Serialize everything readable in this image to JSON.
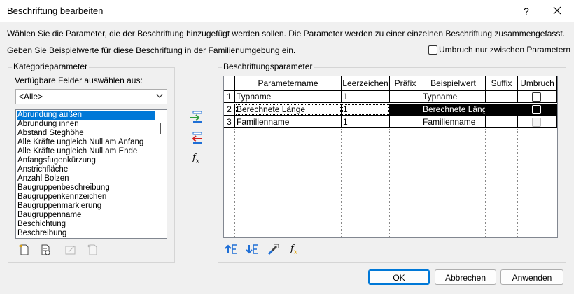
{
  "window": {
    "title": "Beschriftung bearbeiten",
    "help_label": "?"
  },
  "descriptions": {
    "line1": "Wählen Sie die Parameter, die der Beschriftung hinzugefügt werden sollen. Die Parameter werden zu einer einzelnen Beschriftung zusammengefasst.",
    "line2": "Geben Sie Beispielwerte für diese Beschriftung in der Familienumgebung ein."
  },
  "wrap_option": {
    "label": "Umbruch nur zwischen Parametern",
    "checked": false
  },
  "category": {
    "group_label": "Kategorieparameter",
    "fields_label": "Verfügbare Felder auswählen aus:",
    "filter_value": "<Alle>",
    "items": [
      "Abrundung außen",
      "Abrundung innen",
      "Abstand Steghöhe",
      "Alle Kräfte ungleich Null am Anfang",
      "Alle Kräfte ungleich Null am Ende",
      "Anfangsfugenkürzung",
      "Anstrichfläche",
      "Anzahl Bolzen",
      "Baugruppenbeschreibung",
      "Baugruppenkennzeichen",
      "Baugruppenmarkierung",
      "Baugruppenname",
      "Beschichtung",
      "Beschreibung"
    ],
    "selected_index": 0,
    "toolbar_icons": [
      "new-parameter-icon",
      "edit-parameter-icon",
      "delete-parameter-icon",
      "paste-parameter-icon"
    ]
  },
  "transfer_buttons": [
    "add-parameter-icon",
    "remove-parameter-icon",
    "formula-icon"
  ],
  "label_params": {
    "group_label": "Beschriftungsparameter",
    "columns": [
      "",
      "Parametername",
      "Leerzeichen",
      "Präfix",
      "Beispielwert",
      "Suffix",
      "Umbruch"
    ],
    "rows": [
      {
        "num": "1",
        "name": "Typname",
        "spaces": "1",
        "prefix": "",
        "sample": "Typname",
        "suffix": "",
        "wrap": false,
        "wrap_enabled": true
      },
      {
        "num": "2",
        "name": "Berechnete Länge",
        "spaces": "1",
        "prefix": "",
        "sample": "Berechnete Läng",
        "suffix": "",
        "wrap": false,
        "wrap_enabled": true
      },
      {
        "num": "3",
        "name": "Familienname",
        "spaces": "1",
        "prefix": "",
        "sample": "Familienname",
        "suffix": "",
        "wrap": false,
        "wrap_enabled": false
      }
    ],
    "selected_row": 1,
    "toolbar_icons": [
      "move-up-icon",
      "move-down-icon",
      "edit-label-format-icon",
      "formula-edit-icon"
    ]
  },
  "buttons": {
    "ok": "OK",
    "cancel": "Abbrechen",
    "apply": "Anwenden"
  },
  "colors": {
    "selection": "#0078d7",
    "row_selected": "#000000",
    "add_arrow": "#2e9e3e",
    "remove_arrow": "#d21f1f",
    "move_arrow": "#1f6fd6"
  }
}
